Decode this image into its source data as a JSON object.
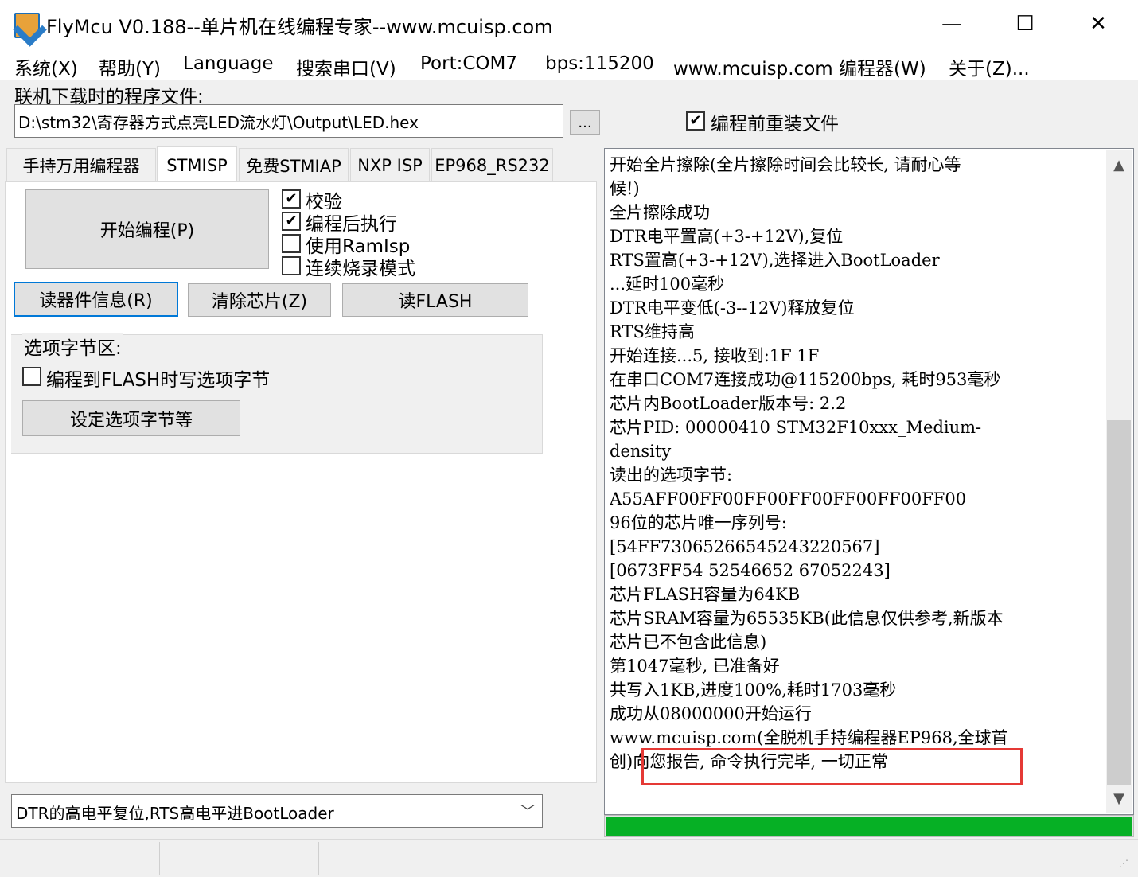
{
  "window": {
    "title": "FlyMcu V0.188--单片机在线编程专家--www.mcuisp.com",
    "minimize_label": "—",
    "maximize_label": "☐",
    "close_label": "✕"
  },
  "menu": {
    "items": [
      "系统(X)",
      "帮助(Y)",
      "Language",
      "搜索串口(V)",
      "Port:COM7",
      "bps:115200",
      "www.mcuisp.com 编程器(W)",
      "关于(Z)..."
    ]
  },
  "file": {
    "label": "联机下载时的程序文件:",
    "path": "D:\\stm32\\寄存器方式点亮LED流水灯\\Output\\LED.hex",
    "browse_label": "...",
    "reload_label": "编程前重装文件",
    "reload_checked": true
  },
  "tabs": {
    "items": [
      "手持万用编程器",
      "STMISP",
      "免费STMIAP",
      "NXP ISP",
      "EP968_RS232"
    ],
    "active": "STMISP"
  },
  "stmisp": {
    "program_button": "开始编程(P)",
    "options": [
      {
        "label": "校验",
        "checked": true
      },
      {
        "label": "编程后执行",
        "checked": true
      },
      {
        "label": "使用RamIsp",
        "checked": false
      },
      {
        "label": "连续烧录模式",
        "checked": false
      }
    ],
    "read_info_button": "读器件信息(R)",
    "erase_button": "清除芯片(Z)",
    "read_flash_button": "读FLASH",
    "option_group_title": "选项字节区:",
    "option_write_label": "编程到FLASH时写选项字节",
    "option_write_checked": false,
    "set_option_button": "设定选项字节等"
  },
  "reset_mode": {
    "selected": "DTR的高电平复位,RTS高电平进BootLoader"
  },
  "log": {
    "lines": [
      "开始全片擦除(全片擦除时间会比较长, 请耐心等",
      "候!)",
      "全片擦除成功",
      "DTR电平置高(+3-+12V),复位",
      "RTS置高(+3-+12V),选择进入BootLoader",
      "...延时100毫秒",
      "DTR电平变低(-3--12V)释放复位",
      "RTS维持高",
      "开始连接...5, 接收到:1F 1F",
      "在串口COM7连接成功@115200bps, 耗时953毫秒",
      "芯片内BootLoader版本号: 2.2",
      "芯片PID: 00000410  STM32F10xxx_Medium-",
      "density",
      "读出的选项字节:",
      "A55AFF00FF00FF00FF00FF00FF00FF00",
      "96位的芯片唯一序列号:",
      "[54FF7306526654524322056​7]",
      "[0673FF54 52546652 67052243]",
      "芯片FLASH容量为64KB",
      "芯片SRAM容量为65535KB(此信息仅供参考,新版本",
      "芯片已不包含此信息)",
      "第1047毫秒, 已准备好",
      "共写入1KB,进度100%,耗时1703毫秒",
      "成功从08000000开始运行",
      "www.mcuisp.com(全脱机手持编程器EP968,全球首",
      "创)向您报告, 命令执行完毕, 一切正常"
    ],
    "scroll_up": "▲",
    "scroll_down": "▼",
    "highlight_color": "#e53935"
  },
  "progress": {
    "value": 1.0,
    "color": "#06b025"
  },
  "combo_arrow": "﹀",
  "grip": "⋰"
}
